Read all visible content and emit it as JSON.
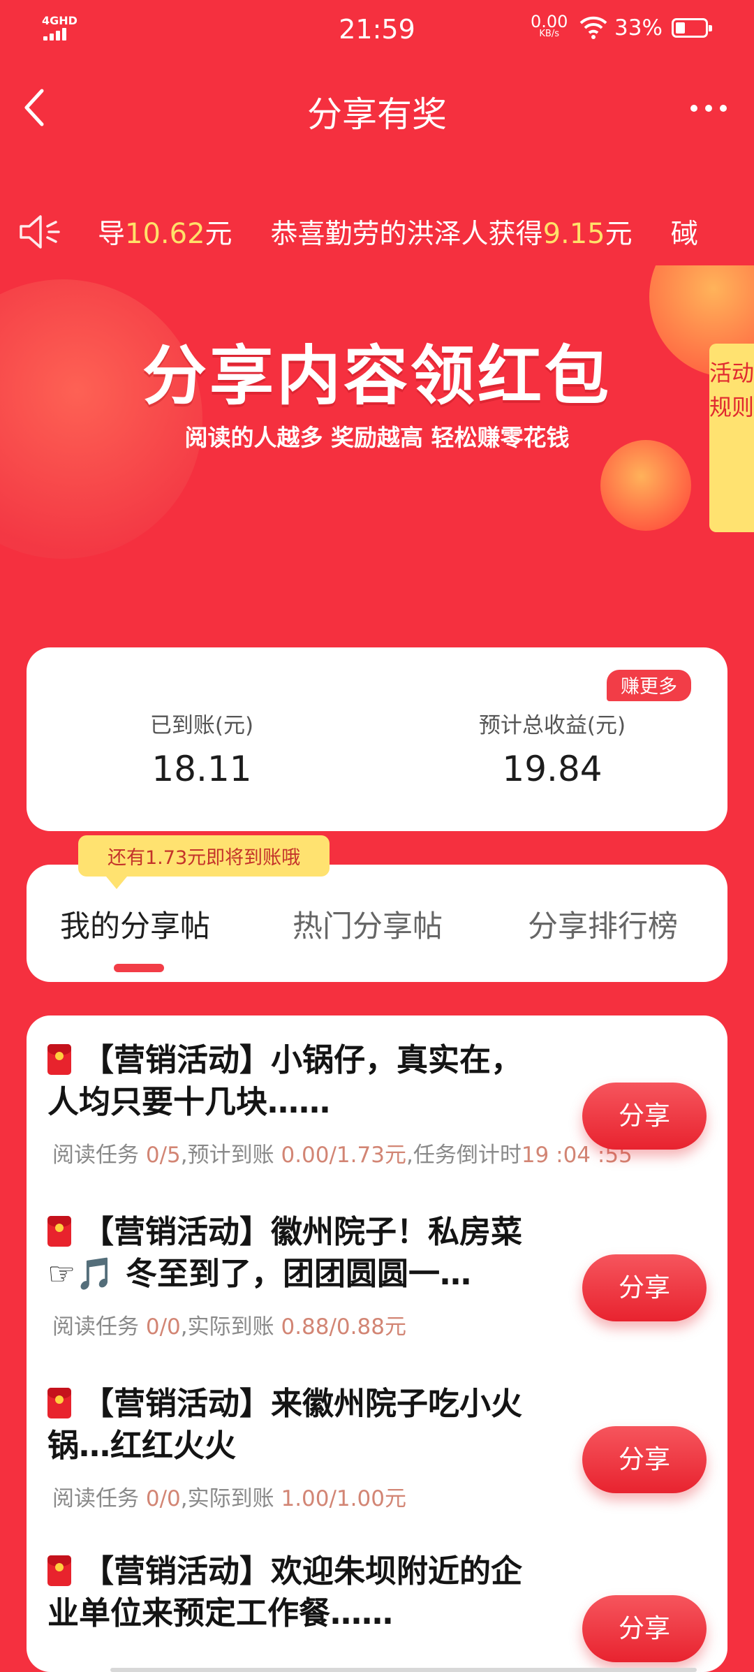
{
  "status_bar": {
    "network": "4GHD",
    "time": "21:59",
    "speed_value": "0.00",
    "speed_unit": "KB/s",
    "battery": "33%",
    "battery_level": 0.33
  },
  "header": {
    "title": "分享有奖"
  },
  "ticker": {
    "items": [
      {
        "prefix": "导",
        "amount": "10.62",
        "suffix": "元"
      },
      {
        "prefix": "恭喜勤劳的洪泽人获得",
        "amount": "9.15",
        "suffix": "元"
      },
      {
        "prefix": "䂸",
        "amount": "",
        "suffix": ""
      }
    ]
  },
  "banner": {
    "title": "分享内容领红包",
    "subtitle": "阅读的人越多  奖励越高  轻松赚零花钱",
    "rules_tab": "活动规则"
  },
  "earnings": {
    "more_badge": "赚更多",
    "received_label": "已到账(元)",
    "received_value": "18.11",
    "expected_label": "预计总收益(元)",
    "expected_value": "19.84"
  },
  "tooltip": "还有1.73元即将到账哦",
  "tabs": [
    {
      "label": "我的分享帖",
      "active": true
    },
    {
      "label": "热门分享帖",
      "active": false
    },
    {
      "label": "分享排行榜",
      "active": false
    }
  ],
  "posts": [
    {
      "title": "【营销活动】小锅仔，真实在，人均只要十几块……",
      "meta": [
        {
          "t": "阅读任务 ",
          "hl": false
        },
        {
          "t": "0/5",
          "hl": true
        },
        {
          "t": ",预计到账 ",
          "hl": false
        },
        {
          "t": "0.00/1.73元",
          "hl": true
        },
        {
          "t": ",任务倒计时",
          "hl": false
        },
        {
          "t": "19 :04 :55",
          "hl": true
        }
      ],
      "share_label": "分享"
    },
    {
      "title": "【营销活动】徽州院子！私房菜☞🎵 冬至到了，团团圆圆一…",
      "meta": [
        {
          "t": "阅读任务 ",
          "hl": false
        },
        {
          "t": "0/0",
          "hl": true
        },
        {
          "t": ",实际到账 ",
          "hl": false
        },
        {
          "t": "0.88/0.88元",
          "hl": true
        }
      ],
      "share_label": "分享"
    },
    {
      "title": "【营销活动】来徽州院子吃小火锅…红红火火",
      "meta": [
        {
          "t": "阅读任务 ",
          "hl": false
        },
        {
          "t": "0/0",
          "hl": true
        },
        {
          "t": ",实际到账 ",
          "hl": false
        },
        {
          "t": "1.00/1.00元",
          "hl": true
        }
      ],
      "share_label": "分享"
    },
    {
      "title": "【营销活动】欢迎朱坝附近的企业单位来预定工作餐……",
      "meta": [],
      "share_label": "分享"
    }
  ]
}
